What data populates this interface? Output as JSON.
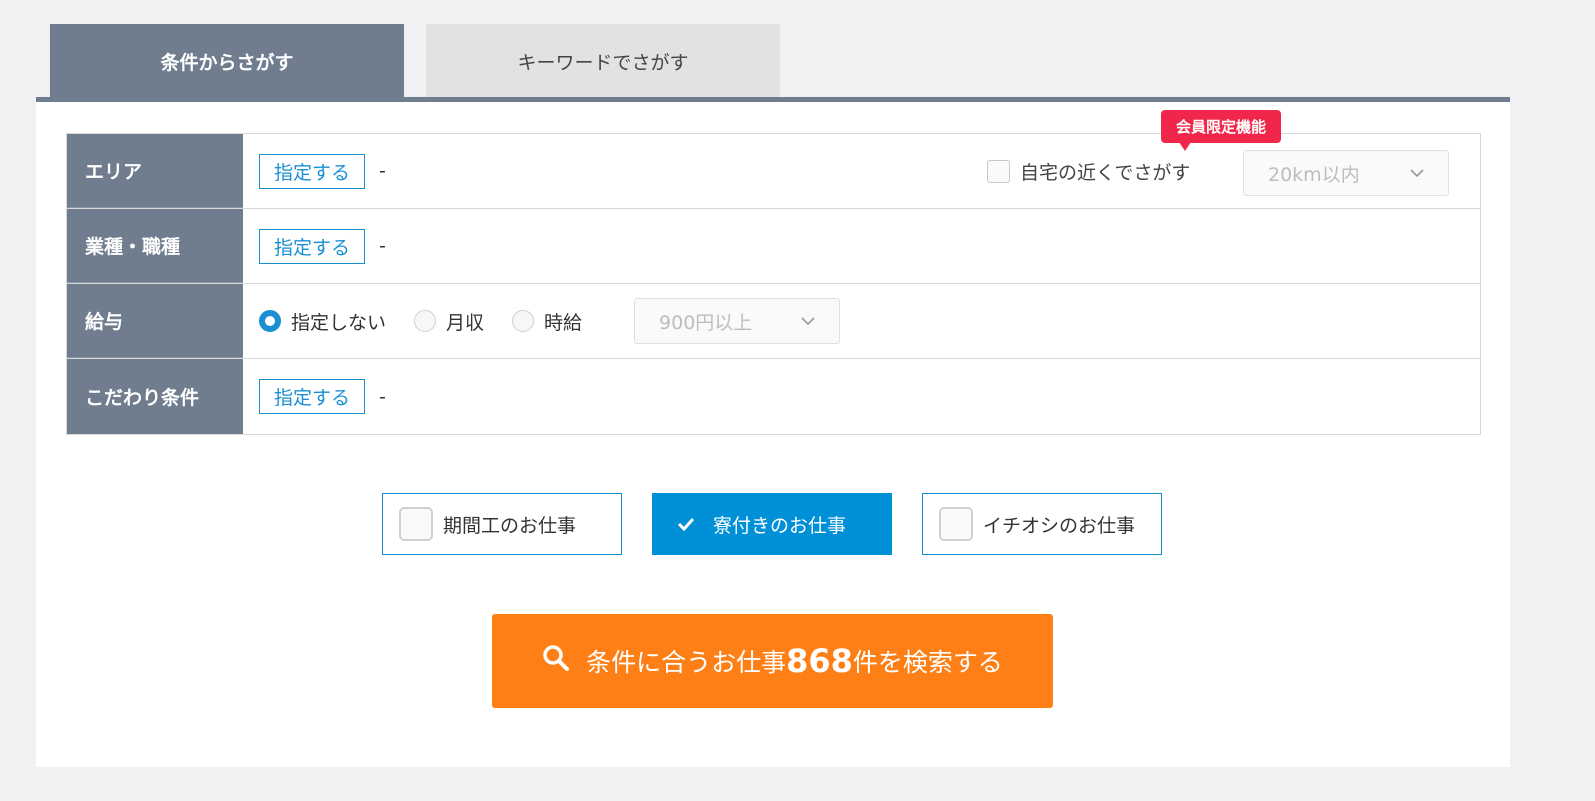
{
  "tabs": [
    {
      "label": "条件からさがす",
      "active": true
    },
    {
      "label": "キーワードでさがす",
      "active": false
    }
  ],
  "rows": {
    "area": {
      "label": "エリア",
      "button": "指定する",
      "value": "-"
    },
    "industry": {
      "label": "業種・職種",
      "button": "指定する",
      "value": "-"
    },
    "salary": {
      "label": "給与",
      "options": [
        {
          "label": "指定しない",
          "checked": true
        },
        {
          "label": "月収",
          "checked": false
        },
        {
          "label": "時給",
          "checked": false
        }
      ],
      "select": "900円以上"
    },
    "conditions": {
      "label": "こだわり条件",
      "button": "指定する",
      "value": "-"
    }
  },
  "near_home": {
    "badge": "会員限定機能",
    "label": "自宅の近くでさがす",
    "checked": false,
    "select": "20km以内"
  },
  "chips": [
    {
      "label": "期間工のお仕事",
      "selected": false
    },
    {
      "label": "寮付きのお仕事",
      "selected": true
    },
    {
      "label": "イチオシのお仕事",
      "selected": false
    }
  ],
  "search": {
    "prefix": "条件に合うお仕事",
    "count": "868",
    "suffix": "件を検索する"
  },
  "colors": {
    "tab_active": "#707d8f",
    "accent_blue": "#1a8fd4",
    "badge_red": "#f0274a",
    "search_orange": "#ff7f17"
  }
}
